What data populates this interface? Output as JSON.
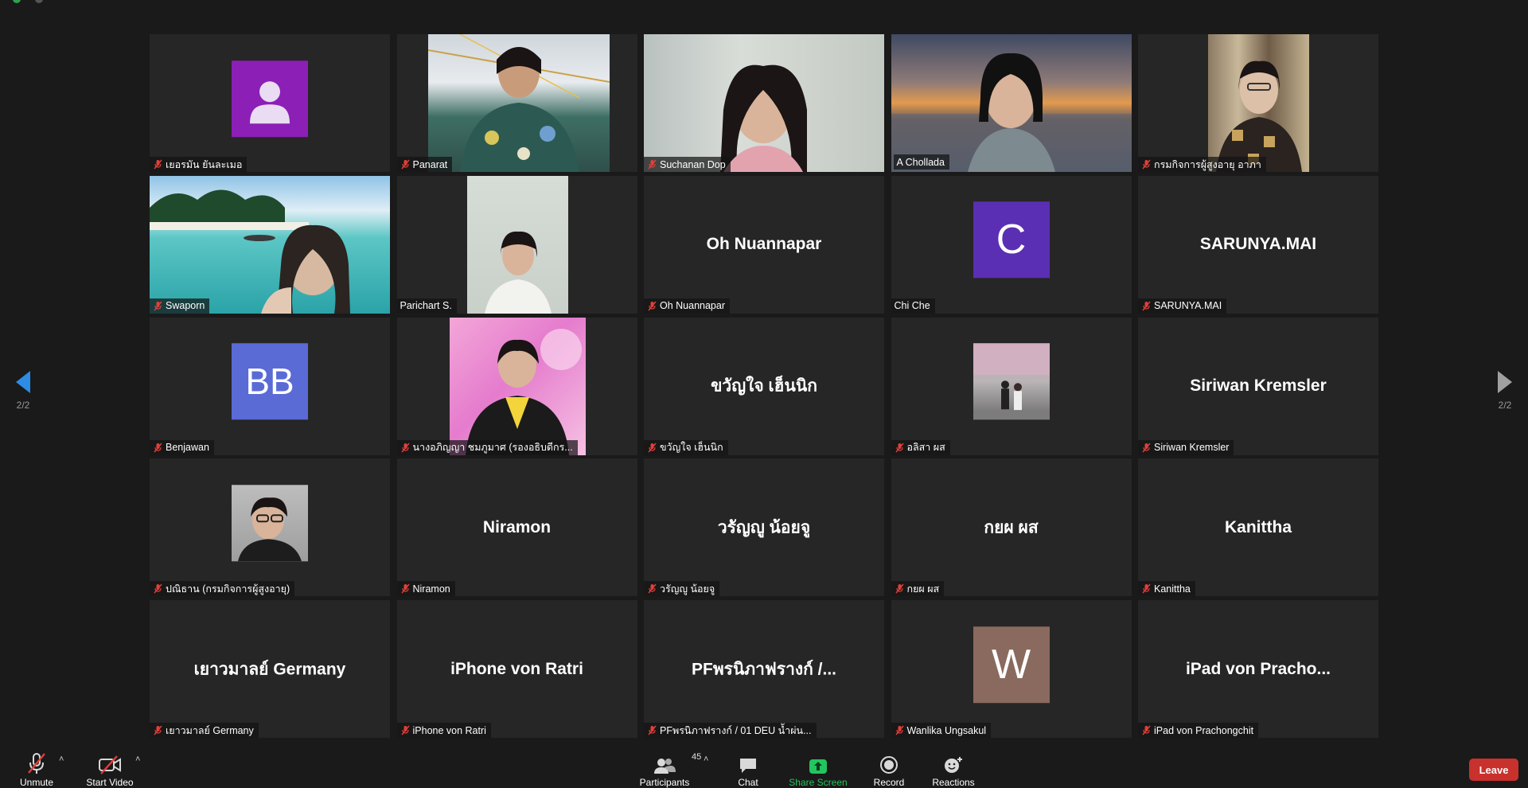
{
  "pager": {
    "left": "2/2",
    "right": "2/2"
  },
  "tiles": [
    {
      "label": "เยอรมัน ยันละเมอ",
      "kind": "avatar",
      "avatar_color": "#8c1fb5",
      "avatar_glyph": "person-icon",
      "muted": true
    },
    {
      "label": "Panarat",
      "kind": "video",
      "muted": true
    },
    {
      "label": "Suchanan Dop",
      "kind": "video",
      "muted": true
    },
    {
      "label": "A Chollada",
      "kind": "video",
      "muted": false,
      "active": true
    },
    {
      "label": "กรมกิจการผู้สูงอายุ อาภา",
      "kind": "video",
      "muted": true
    },
    {
      "label": "Swaporn",
      "kind": "video",
      "muted": true
    },
    {
      "label": "Parichart S.",
      "kind": "video",
      "muted": false
    },
    {
      "label": "Oh Nuannapar",
      "big": "Oh Nuannapar",
      "kind": "name",
      "muted": true
    },
    {
      "label": "Chi Che",
      "kind": "avatar",
      "avatar_color": "#5b2fb3",
      "avatar_text": "C",
      "muted": false
    },
    {
      "label": "SARUNYA.MAI",
      "big": "SARUNYA.MAI",
      "kind": "name",
      "muted": true
    },
    {
      "label": "Benjawan",
      "kind": "avatar",
      "avatar_color": "#5a6bd6",
      "avatar_text": "BB",
      "muted": true
    },
    {
      "label": "นางอภิญญา ชมภูมาศ (รองอธิบดีกร...",
      "kind": "video",
      "muted": true
    },
    {
      "label": "ขวัญใจ เฮ็นนิก",
      "big": "ขวัญใจ เฮ็นนิก",
      "kind": "name",
      "muted": true
    },
    {
      "label": "อลิสา ผส",
      "kind": "photo",
      "muted": true
    },
    {
      "label": "Siriwan Kremsler",
      "big": "Siriwan Kremsler",
      "kind": "name",
      "muted": true
    },
    {
      "label": "ปณิธาน (กรมกิจการผู้สูงอายุ)",
      "kind": "photo",
      "muted": true
    },
    {
      "label": "Niramon",
      "big": "Niramon",
      "kind": "name",
      "muted": true
    },
    {
      "label": "วรัญญู น้อยจู",
      "big": "วรัญญู น้อยจู",
      "kind": "name",
      "muted": true
    },
    {
      "label": "กยผ ผส",
      "big": "กยผ ผส",
      "kind": "name",
      "muted": true
    },
    {
      "label": "Kanittha",
      "big": "Kanittha",
      "kind": "name",
      "muted": true
    },
    {
      "label": "เยาวมาลย์ Germany",
      "big": "เยาวมาลย์ Germany",
      "kind": "name",
      "muted": true
    },
    {
      "label": "iPhone von Ratri",
      "big": "iPhone von Ratri",
      "kind": "name",
      "muted": true
    },
    {
      "label": "PFพรนิภาฟรางก์ / 01 DEU น้ำผ่น...",
      "big": "PFพรนิภาฟรางก์ /...",
      "kind": "name",
      "muted": true
    },
    {
      "label": "Wanlika Ungsakul",
      "kind": "avatar",
      "avatar_color": "#8a6a5e",
      "avatar_text": "W",
      "muted": true
    },
    {
      "label": "iPad von Prachongchit",
      "big": "iPad von Pracho...",
      "kind": "name",
      "muted": true
    }
  ],
  "toolbar": {
    "unmute": "Unmute",
    "start_video": "Start Video",
    "participants": "Participants",
    "participants_count": "45",
    "chat": "Chat",
    "share_screen": "Share Screen",
    "record": "Record",
    "reactions": "Reactions",
    "leave": "Leave"
  },
  "colors": {
    "background": "#1a1a1a",
    "tile": "#262626",
    "active_outline": "#d7e284",
    "muted_icon": "#e0403a",
    "share_green": "#22c55e",
    "leave_red": "#c9312c",
    "pager_arrow_left": "#2d8ce4",
    "pager_arrow_right": "#a0a0a0"
  }
}
